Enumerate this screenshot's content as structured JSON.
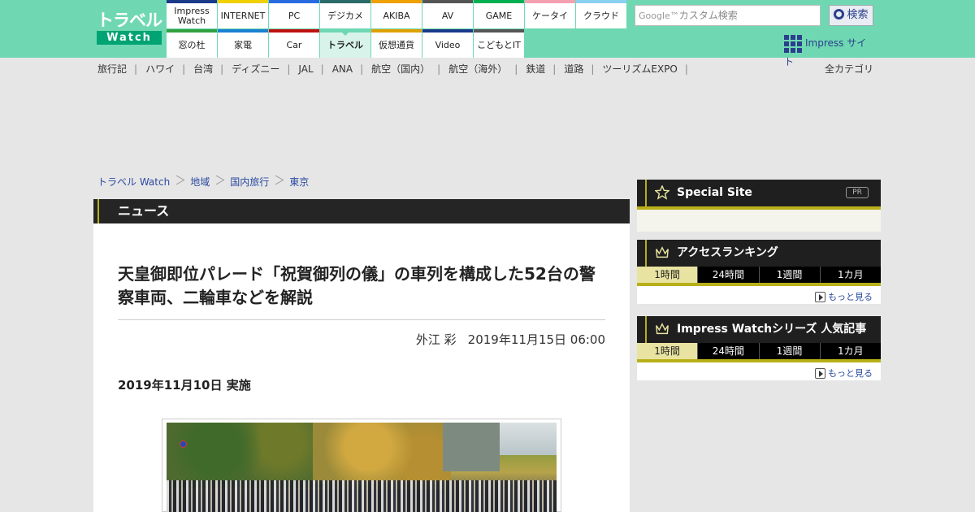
{
  "header": {
    "logo": {
      "top": "トラベル",
      "bottom": "Watch"
    },
    "nav": [
      {
        "label": "Impress Watch",
        "color": "#1a3a8a"
      },
      {
        "label": "INTERNET",
        "color": "#f0d000"
      },
      {
        "label": "PC",
        "color": "#2a6ae0"
      },
      {
        "label": "デジカメ",
        "color": "#2a6a6a"
      },
      {
        "label": "AKIBA",
        "color": "#f0a000"
      },
      {
        "label": "AV",
        "color": "#555555"
      },
      {
        "label": "GAME",
        "color": "#00b050"
      },
      {
        "label": "ケータイ",
        "color": "#f4a0b0"
      },
      {
        "label": "クラウド",
        "color": "#8ad0f0"
      },
      {
        "label": "窓の杜",
        "color": "#30a040"
      },
      {
        "label": "家電",
        "color": "#1a80d0"
      },
      {
        "label": "Car",
        "color": "#c01010"
      },
      {
        "label": "トラベル",
        "color": "#6fd8b3",
        "active": true
      },
      {
        "label": "仮想通貨",
        "color": "#e0a000"
      },
      {
        "label": "Video",
        "color": "#1a3a8a"
      },
      {
        "label": "こどもとIT",
        "color": "#555555"
      }
    ],
    "search": {
      "brand": "Google™",
      "placeholder": "カスタム検索",
      "button": "検索"
    },
    "impress_site": "Impress サイト"
  },
  "categories": [
    "旅行記",
    "ハワイ",
    "台湾",
    "ディズニー",
    "JAL",
    "ANA",
    "航空（国内）",
    "航空（海外）",
    "鉄道",
    "道路",
    "ツーリズムEXPO"
  ],
  "all_categories": "全カテゴリ",
  "breadcrumb": [
    "トラベル Watch",
    "地域",
    "国内旅行",
    "東京"
  ],
  "article": {
    "section": "ニュース",
    "title": "天皇御即位パレード「祝賀御列の儀」の車列を構成した52台の警察車両、二輪車などを解説",
    "author": "外江 彩",
    "date": "2019年11月15日 06:00",
    "event_date": "2019年11月10日 実施"
  },
  "sidebar": {
    "special": {
      "title": "Special Site",
      "pr": "PR"
    },
    "ranking": {
      "title": "アクセスランキング",
      "tabs": [
        "1時間",
        "24時間",
        "1週間",
        "1カ月"
      ],
      "more": "もっと見る"
    },
    "series": {
      "title": "Impress Watchシリーズ 人気記事",
      "tabs": [
        "1時間",
        "24時間",
        "1週間",
        "1カ月"
      ],
      "more": "もっと見る"
    }
  },
  "colors": {
    "header_green": "#6fd8b3",
    "accent_olive": "#b8b018",
    "link_blue": "#2b4aa0"
  }
}
